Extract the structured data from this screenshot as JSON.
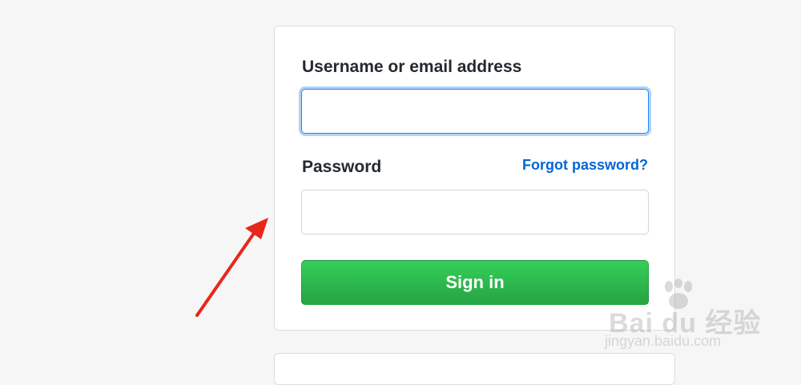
{
  "login": {
    "username_label": "Username or email address",
    "username_value": "",
    "password_label": "Password",
    "password_value": "",
    "forgot_link": "Forgot password?",
    "submit_label": "Sign in"
  },
  "watermark": {
    "main": "Bai du 经验",
    "sub": "jingyan.baidu.com"
  },
  "colors": {
    "page_background": "#f6f6f6",
    "link": "#0366d6",
    "button_green": "#2ebd4d",
    "focus_border": "#2188ff",
    "arrow": "#e8261c"
  }
}
